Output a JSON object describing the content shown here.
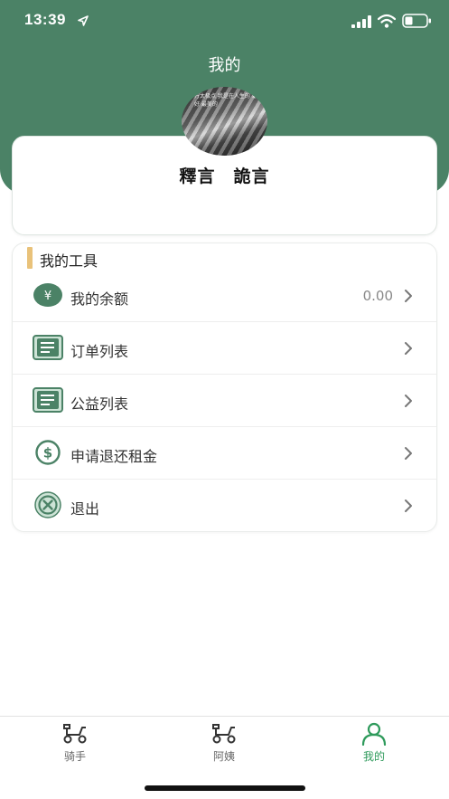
{
  "status_bar": {
    "time": "13:39"
  },
  "header": {
    "title": "我的"
  },
  "profile": {
    "username": "釋言　詭言",
    "avatar_overlay_text": "万太极点 我是在人生的 最好 最美的"
  },
  "tools": {
    "section_title": "我的工具",
    "items": [
      {
        "label": "我的余额",
        "value": "0.00",
        "icon": "yen-icon"
      },
      {
        "label": "订单列表",
        "value": "",
        "icon": "list-icon"
      },
      {
        "label": "公益列表",
        "value": "",
        "icon": "list-icon"
      },
      {
        "label": "申请退还租金",
        "value": "",
        "icon": "dollar-icon"
      },
      {
        "label": "退出",
        "value": "",
        "icon": "logout-icon"
      }
    ]
  },
  "tabbar": {
    "tabs": [
      {
        "label": "骑手",
        "icon": "scooter-icon",
        "active": false
      },
      {
        "label": "阿姨",
        "icon": "scooter-icon",
        "active": false
      },
      {
        "label": "我的",
        "icon": "person-icon",
        "active": true
      }
    ]
  },
  "colors": {
    "brand_green": "#4b8266",
    "active_tab": "#2e9a5b",
    "accent_bar": "#e9c27a"
  }
}
